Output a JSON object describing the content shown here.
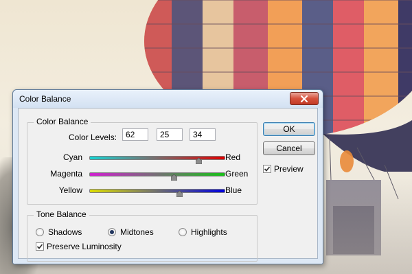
{
  "dialog": {
    "title": "Color Balance"
  },
  "color_balance": {
    "group_label": "Color Balance",
    "levels_label": "Color Levels:",
    "levels": [
      "62",
      "25",
      "34"
    ],
    "sliders": [
      {
        "left": "Cyan",
        "right": "Red",
        "value": 62,
        "min": -100,
        "max": 100,
        "left_color": "#17d4d4",
        "right_color": "#e10000"
      },
      {
        "left": "Magenta",
        "right": "Green",
        "value": 25,
        "min": -100,
        "max": 100,
        "left_color": "#d01fd0",
        "right_color": "#18c018"
      },
      {
        "left": "Yellow",
        "right": "Blue",
        "value": 34,
        "min": -100,
        "max": 100,
        "left_color": "#dede00",
        "right_color": "#0000e0"
      }
    ]
  },
  "tone_balance": {
    "group_label": "Tone Balance",
    "options": [
      "Shadows",
      "Midtones",
      "Highlights"
    ],
    "selected": "Midtones",
    "preserve_luminosity_label": "Preserve Luminosity",
    "preserve_luminosity": true
  },
  "buttons": {
    "ok": "OK",
    "cancel": "Cancel"
  },
  "preview": {
    "label": "Preview",
    "checked": true
  },
  "icons": {
    "close": "close-icon",
    "check": "checkmark-icon"
  }
}
